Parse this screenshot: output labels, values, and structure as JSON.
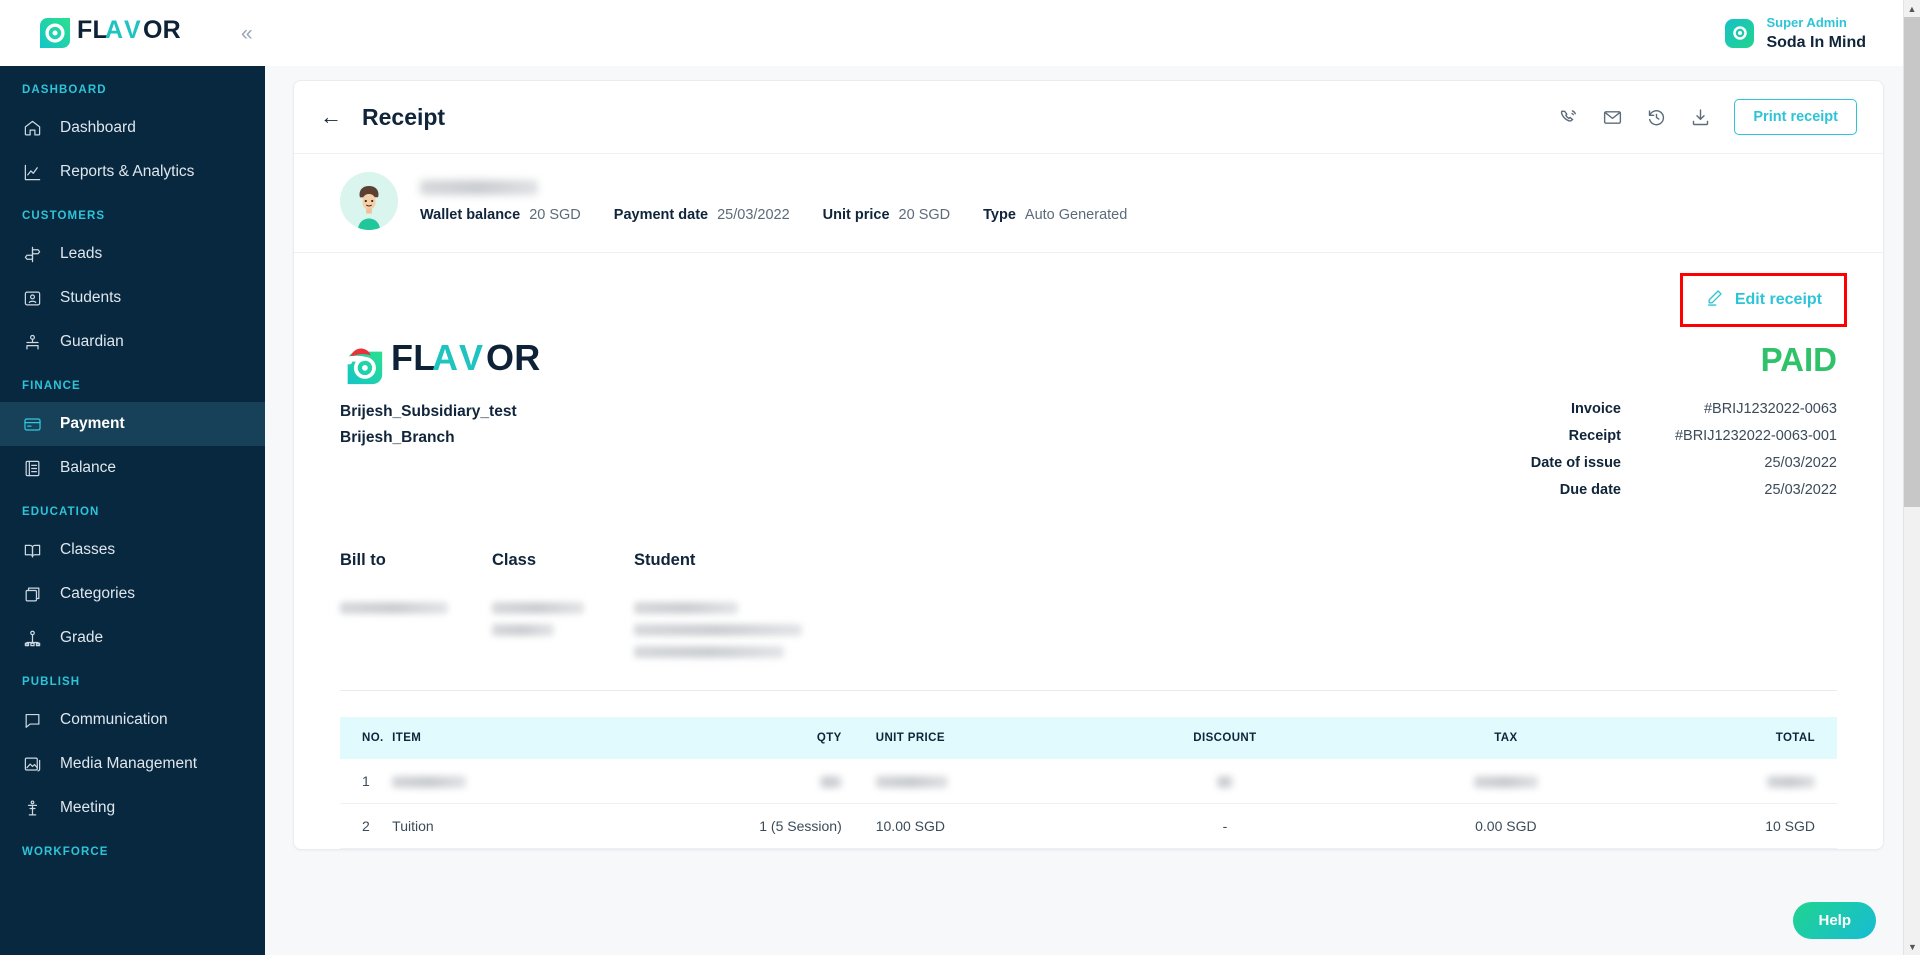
{
  "sidebar": {
    "brand": "FLAVOR",
    "collapse_icon": "chevron-double-left-icon",
    "groups": [
      {
        "label": "DASHBOARD",
        "items": [
          {
            "label": "Dashboard",
            "icon": "home-icon",
            "active": false
          },
          {
            "label": "Reports & Analytics",
            "icon": "chart-line-icon",
            "active": false
          }
        ]
      },
      {
        "label": "CUSTOMERS",
        "items": [
          {
            "label": "Leads",
            "icon": "signpost-icon",
            "active": false
          },
          {
            "label": "Students",
            "icon": "id-card-icon",
            "active": false
          },
          {
            "label": "Guardian",
            "icon": "guardian-icon",
            "active": false
          }
        ]
      },
      {
        "label": "FINANCE",
        "items": [
          {
            "label": "Payment",
            "icon": "credit-card-icon",
            "active": true
          },
          {
            "label": "Balance",
            "icon": "ledger-icon",
            "active": false
          }
        ]
      },
      {
        "label": "EDUCATION",
        "items": [
          {
            "label": "Classes",
            "icon": "book-open-icon",
            "active": false
          },
          {
            "label": "Categories",
            "icon": "boxes-icon",
            "active": false
          },
          {
            "label": "Grade",
            "icon": "hierarchy-icon",
            "active": false
          }
        ]
      },
      {
        "label": "PUBLISH",
        "items": [
          {
            "label": "Communication",
            "icon": "chat-bubble-icon",
            "active": false
          },
          {
            "label": "Media Management",
            "icon": "image-stack-icon",
            "active": false
          },
          {
            "label": "Meeting",
            "icon": "podium-icon",
            "active": false
          }
        ]
      },
      {
        "label": "WORKFORCE",
        "items": []
      }
    ]
  },
  "topbar": {
    "user_role": "Super Admin",
    "user_name": "Soda In Mind",
    "logo_icon": "flavor-circle-icon"
  },
  "receipt_header": {
    "back_icon": "arrow-left-icon",
    "title": "Receipt",
    "actions": [
      {
        "icon": "phone-call-icon",
        "name": "call-action"
      },
      {
        "icon": "envelope-icon",
        "name": "email-action"
      },
      {
        "icon": "history-icon",
        "name": "history-action"
      },
      {
        "icon": "download-icon",
        "name": "download-action"
      }
    ],
    "print_label": "Print receipt"
  },
  "profile": {
    "avatar_icon": "user-avatar-icon",
    "name_redacted": true,
    "meta": [
      {
        "key": "Wallet balance",
        "value": "20 SGD"
      },
      {
        "key": "Payment date",
        "value": "25/03/2022"
      },
      {
        "key": "Unit price",
        "value": "20 SGD"
      },
      {
        "key": "Type",
        "value": "Auto Generated"
      }
    ]
  },
  "edit": {
    "label": "Edit receipt",
    "icon": "pencil-icon",
    "highlight_color": "#ff0000"
  },
  "document": {
    "brand": "FLAVOR",
    "brand_icon": "flavor-santa-logo-icon",
    "subsidiary": "Brijesh_Subsidiary_test",
    "branch": "Brijesh_Branch",
    "status": "PAID",
    "status_color": "#2fc26a",
    "details": [
      {
        "key": "Invoice",
        "value": "#BRIJ1232022-0063"
      },
      {
        "key": "Receipt",
        "value": "#BRIJ1232022-0063-001"
      },
      {
        "key": "Date of issue",
        "value": "25/03/2022"
      },
      {
        "key": "Due date",
        "value": "25/03/2022"
      }
    ],
    "columns": [
      {
        "heading": "Bill to",
        "lines_redacted": 1
      },
      {
        "heading": "Class",
        "lines_redacted": 2
      },
      {
        "heading": "Student",
        "lines_redacted": 3
      }
    ],
    "table": {
      "headers": [
        "NO.",
        "ITEM",
        "QTY",
        "UNIT PRICE",
        "DISCOUNT",
        "TAX",
        "TOTAL"
      ],
      "rows": [
        {
          "no": "1",
          "item": "",
          "qty": "",
          "unit_price": "",
          "discount": "",
          "tax": "",
          "total": "",
          "redacted": true
        },
        {
          "no": "2",
          "item": "Tuition",
          "qty": "1 (5 Session)",
          "unit_price": "10.00 SGD",
          "discount": "-",
          "tax": "0.00 SGD",
          "total": "10 SGD",
          "redacted": false
        }
      ]
    }
  },
  "help": {
    "label": "Help"
  },
  "scrollbar": {
    "up_icon": "chevron-up-icon",
    "down_icon": "chevron-down-icon"
  }
}
